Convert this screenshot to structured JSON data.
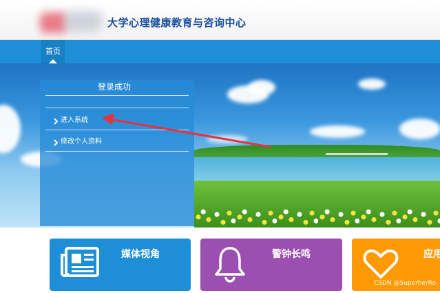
{
  "header": {
    "site_title": "大学心理健康教育与咨询中心"
  },
  "nav": {
    "items": [
      {
        "label": "首页"
      }
    ]
  },
  "login_panel": {
    "title": "登录成功",
    "menu": [
      {
        "label": "进入系统",
        "icon": "chevron-right-icon"
      },
      {
        "label": "修改个人资料",
        "icon": "chevron-right-icon"
      }
    ]
  },
  "tiles": [
    {
      "label": "媒体视角",
      "icon": "newspaper-icon",
      "color": "#1e8ed6"
    },
    {
      "label": "警钟长鸣",
      "icon": "bell-icon",
      "color": "#9b4fb0"
    },
    {
      "label": "应用",
      "icon": "heart-icon",
      "color": "#ff9a05"
    }
  ],
  "annotation": {
    "arrow_color": "#e8323c"
  },
  "watermark": "CSDN @SuperherRo",
  "colors": {
    "accent": "#1e8ed6",
    "title": "#1a4f9e"
  }
}
